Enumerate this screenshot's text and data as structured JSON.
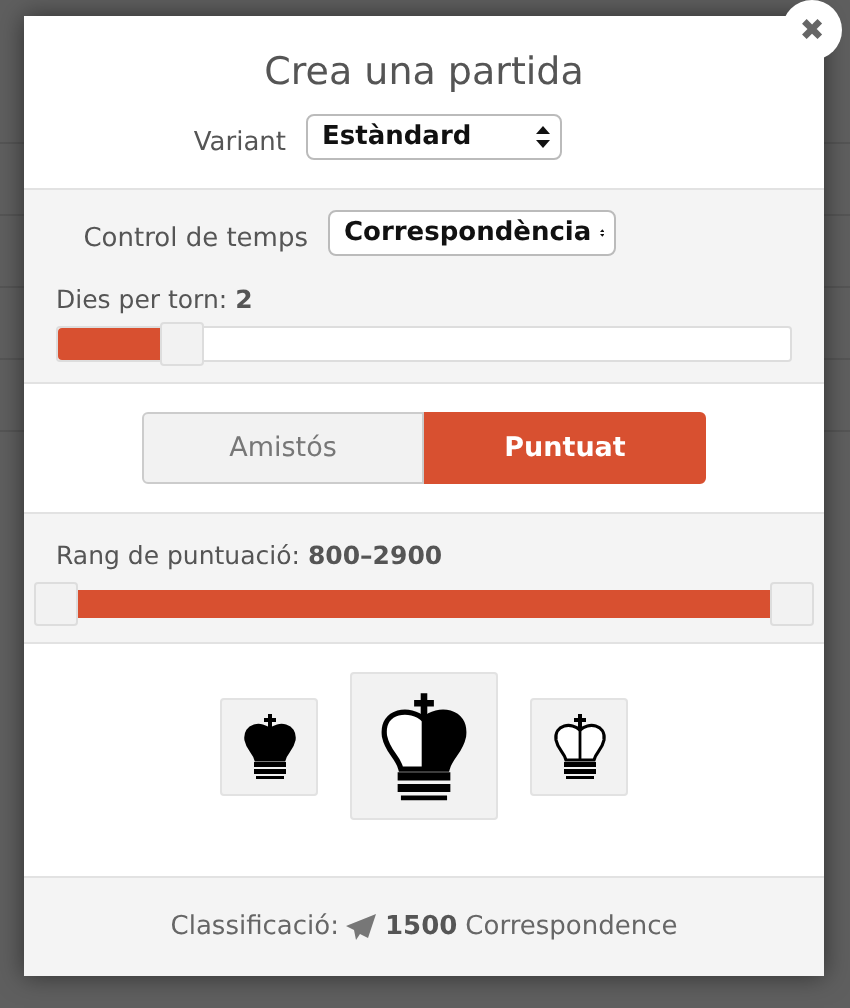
{
  "dialog": {
    "close": "✖",
    "title": "Crea una partida",
    "variant": {
      "label": "Variant",
      "value": "Estàndard"
    },
    "time_control": {
      "label": "Control de temps",
      "value": "Correspondència"
    },
    "days_slider": {
      "label": "Dies per torn: ",
      "value": "2",
      "level": 0.17
    },
    "mode_tabs": [
      {
        "label": "Amistós",
        "selected": false
      },
      {
        "label": "Puntuat",
        "selected": true
      }
    ],
    "rating_range": {
      "label": "Rang de puntuació: ",
      "value": "800–2900"
    },
    "color_buttons": [
      {
        "kind": "black"
      },
      {
        "kind": "random"
      },
      {
        "kind": "white"
      }
    ],
    "footer": {
      "label": "Classificació: ",
      "rating": "1500",
      "perf": "Correspondence"
    }
  }
}
